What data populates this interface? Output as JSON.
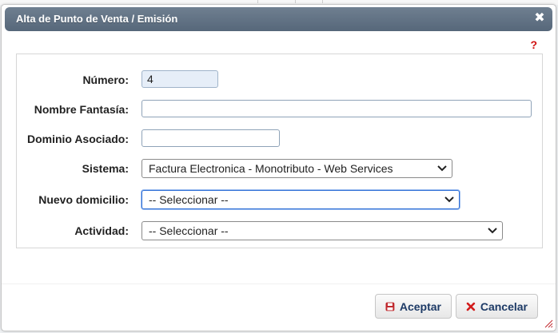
{
  "dialog": {
    "title": "Alta de Punto de Venta / Emisión",
    "help": "?",
    "close_glyph": "✖"
  },
  "form": {
    "numero_label": "Número:",
    "numero_value": "4",
    "nombre_label": "Nombre Fantasía:",
    "nombre_value": "",
    "dominio_label": "Dominio Asociado:",
    "dominio_value": "",
    "sistema_label": "Sistema:",
    "sistema_value": "Factura Electronica - Monotributo - Web Services",
    "domicilio_label": "Nuevo domicilio:",
    "domicilio_value": "-- Seleccionar --",
    "actividad_label": "Actividad:",
    "actividad_value": "-- Seleccionar --"
  },
  "buttons": {
    "accept_label": "Aceptar",
    "cancel_label": "Cancelar"
  },
  "colors": {
    "titlebar": "#5f7084",
    "help": "#d01010",
    "accept_icon": "#c0282d",
    "cancel_icon": "#d21c1c",
    "resize_grip": "#c0282d"
  },
  "icons": {
    "close": "close-icon",
    "help": "help-icon",
    "dropdown": "chevron-down-icon",
    "accept": "save-icon",
    "cancel": "x-icon",
    "resize": "resize-grip-icon"
  }
}
